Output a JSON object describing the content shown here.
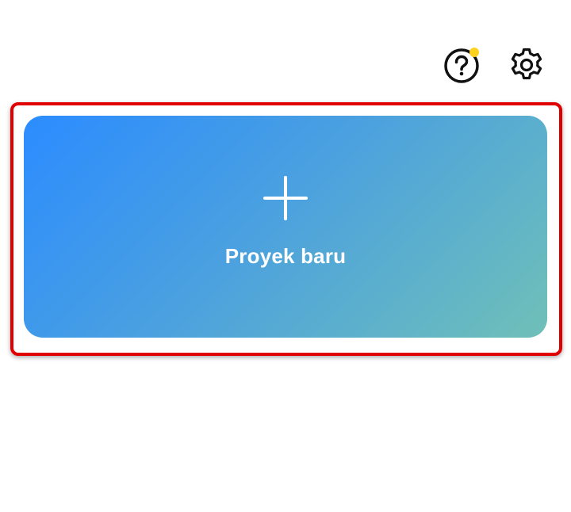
{
  "header": {
    "help_icon": "help-circle-icon",
    "settings_icon": "gear-icon",
    "notification_dot_color": "#ffd21f"
  },
  "new_project": {
    "label": "Proyek baru",
    "icon": "plus-icon",
    "gradient_start": "#2b8cff",
    "gradient_end": "#6fc0b8"
  },
  "highlight": {
    "color": "#e00000"
  }
}
